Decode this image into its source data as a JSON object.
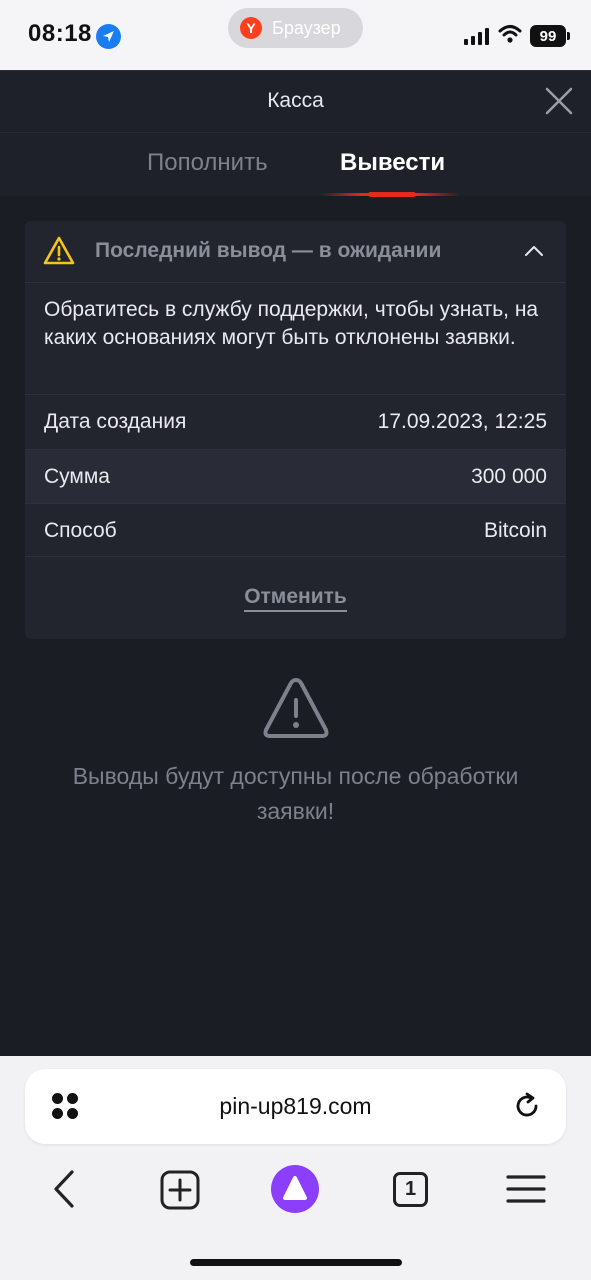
{
  "status_bar": {
    "time": "08:18",
    "app_pill_label": "Браузер",
    "app_pill_logo": "Y",
    "battery": "99"
  },
  "header": {
    "title": "Касса"
  },
  "tabs": {
    "deposit": "Пополнить",
    "withdraw": "Вывести",
    "active": "withdraw"
  },
  "withdrawal_card": {
    "title": "Последний вывод — в ожидании",
    "message": "Обратитесь в службу поддержки, чтобы узнать, на каких основаниях могут быть отклонены заявки.",
    "rows": [
      {
        "label": "Дата создания",
        "value": "17.09.2023, 12:25"
      },
      {
        "label": "Сумма",
        "value": "300 000"
      },
      {
        "label": "Способ",
        "value": "Bitcoin"
      }
    ],
    "cancel_label": "Отменить"
  },
  "notice": {
    "text": "Выводы будут доступны после обработки заявки!"
  },
  "browser": {
    "url": "pin-up819.com",
    "tab_count": "1"
  },
  "colors": {
    "accent": "#e5291d",
    "warning": "#f5c518",
    "background": "#1a1d24",
    "card": "#22252e"
  }
}
